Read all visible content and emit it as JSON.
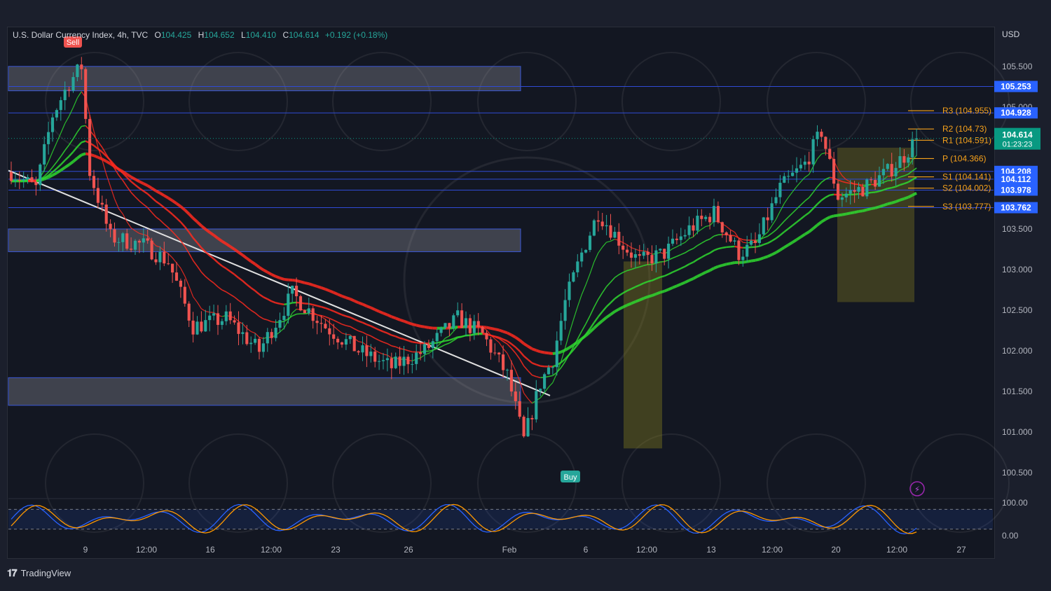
{
  "header": {
    "symbol": "U.S. Dollar Currency Index, 4h, TVC",
    "o_label": "O",
    "o_value": "104.425",
    "h_label": "H",
    "h_value": "104.652",
    "l_label": "L",
    "l_value": "104.410",
    "c_label": "C",
    "c_value": "104.614",
    "change": "+0.192 (+0.18%)",
    "currency": "USD"
  },
  "footer": {
    "brand": "TradingView"
  },
  "signals": {
    "sell": "Sell",
    "buy": "Buy"
  },
  "colors": {
    "up": "#26a69a",
    "down": "#ef5350",
    "bg": "#131722",
    "price_badge": "#089981",
    "level_badge": "#2962ff",
    "pivot": "#f7a21b",
    "ema_up": "#2fd82f",
    "ema_down": "#ff2a1f"
  },
  "price_badge": {
    "value": "104.614",
    "countdown": "01:23:23"
  },
  "chart_data": {
    "type": "candlestick",
    "timeframe": "4h",
    "ylim": [
      100.2,
      105.8
    ],
    "x_ticks": [
      "9",
      "12:00",
      "16",
      "12:00",
      "23",
      "26",
      "Feb",
      "6",
      "12:00",
      "13",
      "12:00",
      "20",
      "12:00",
      "27"
    ],
    "y_ticks": [
      "105.500",
      "105.000",
      "103.500",
      "103.000",
      "102.500",
      "102.000",
      "101.500",
      "101.000",
      "100.500"
    ],
    "horizontal_levels": [
      {
        "value": 105.253,
        "label": "105.253"
      },
      {
        "value": 104.928,
        "label": "104.928"
      },
      {
        "value": 104.208,
        "label": "104.208"
      },
      {
        "value": 104.112,
        "label": "104.112"
      },
      {
        "value": 103.978,
        "label": "103.978"
      },
      {
        "value": 103.762,
        "label": "103.762"
      }
    ],
    "pivots": [
      {
        "name": "R3",
        "value": 104.955,
        "label": "R3 (104.955)"
      },
      {
        "name": "R2",
        "value": 104.73,
        "label": "R2 (104.73)"
      },
      {
        "name": "R1",
        "value": 104.591,
        "label": "R1 (104.591)"
      },
      {
        "name": "P",
        "value": 104.366,
        "label": "P (104.366)"
      },
      {
        "name": "S1",
        "value": 104.141,
        "label": "S1 (104.141)"
      },
      {
        "name": "S2",
        "value": 104.002,
        "label": "S2 (104.002)"
      },
      {
        "name": "S3",
        "value": 103.777,
        "label": "S3 (103.777)"
      }
    ],
    "zones": [
      {
        "x0": 0.0,
        "x1": 0.515,
        "y0": 105.5,
        "y1": 105.2
      },
      {
        "x0": 0.0,
        "x1": 0.515,
        "y0": 103.5,
        "y1": 103.22
      },
      {
        "x0": 0.0,
        "x1": 0.515,
        "y0": 101.67,
        "y1": 101.33
      }
    ],
    "anchors": [
      {
        "i": 0,
        "v": 104.2
      },
      {
        "i": 6,
        "v": 104.0
      },
      {
        "i": 10,
        "v": 104.9
      },
      {
        "i": 14,
        "v": 105.3
      },
      {
        "i": 17,
        "v": 105.5
      },
      {
        "i": 19,
        "v": 104.2
      },
      {
        "i": 24,
        "v": 103.4
      },
      {
        "i": 32,
        "v": 103.3
      },
      {
        "i": 38,
        "v": 103.1
      },
      {
        "i": 44,
        "v": 102.3
      },
      {
        "i": 52,
        "v": 102.4
      },
      {
        "i": 60,
        "v": 102.0
      },
      {
        "i": 68,
        "v": 102.7
      },
      {
        "i": 76,
        "v": 102.3
      },
      {
        "i": 84,
        "v": 102.0
      },
      {
        "i": 92,
        "v": 101.8
      },
      {
        "i": 100,
        "v": 102.0
      },
      {
        "i": 108,
        "v": 102.4
      },
      {
        "i": 114,
        "v": 102.2
      },
      {
        "i": 120,
        "v": 101.7
      },
      {
        "i": 124,
        "v": 100.9
      },
      {
        "i": 128,
        "v": 101.6
      },
      {
        "i": 131,
        "v": 101.9
      },
      {
        "i": 134,
        "v": 102.6
      },
      {
        "i": 138,
        "v": 103.2
      },
      {
        "i": 142,
        "v": 103.7
      },
      {
        "i": 148,
        "v": 103.3
      },
      {
        "i": 152,
        "v": 103.1
      },
      {
        "i": 158,
        "v": 103.2
      },
      {
        "i": 164,
        "v": 103.5
      },
      {
        "i": 170,
        "v": 103.7
      },
      {
        "i": 176,
        "v": 103.2
      },
      {
        "i": 180,
        "v": 103.3
      },
      {
        "i": 186,
        "v": 104.0
      },
      {
        "i": 192,
        "v": 104.3
      },
      {
        "i": 196,
        "v": 104.7
      },
      {
        "i": 200,
        "v": 103.9
      },
      {
        "i": 206,
        "v": 104.0
      },
      {
        "i": 212,
        "v": 104.2
      },
      {
        "i": 216,
        "v": 104.4
      },
      {
        "i": 219,
        "v": 104.614
      }
    ],
    "oscillator": {
      "ylim": [
        0,
        100
      ],
      "labels": [
        "100.00",
        "0.00"
      ],
      "bands": [
        80,
        20
      ]
    }
  }
}
